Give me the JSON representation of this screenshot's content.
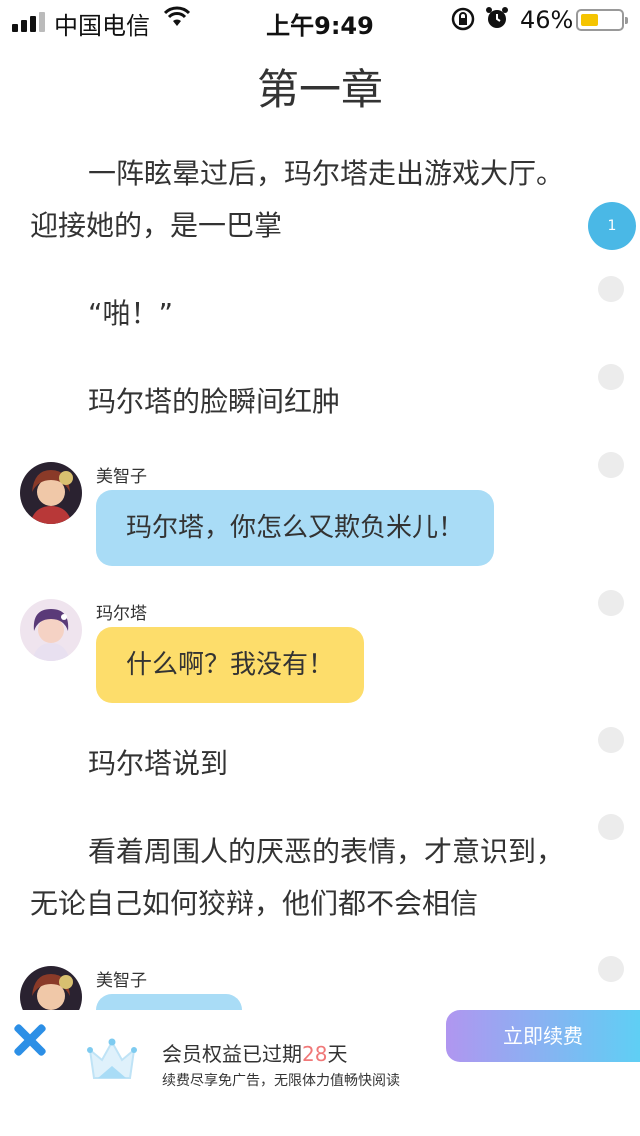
{
  "status_bar": {
    "carrier": "中国电信",
    "time": "上午9:49",
    "battery_percent": "46%",
    "battery_level": 0.46,
    "icons": [
      "signal-icon",
      "wifi-icon",
      "rotation-lock-icon",
      "alarm-icon",
      "battery-icon"
    ]
  },
  "chapter": {
    "title": "第一章",
    "paragraphs": {
      "p1": "一阵眩晕过后，玛尔塔走出游戏大厅。迎接她的，是一巴掌",
      "p2": "“啪！”",
      "p3": "玛尔塔的脸瞬间红肿",
      "p4": "玛尔塔说到",
      "p5": "看着周围人的厌恶的表情，才意识到，无论自己如何狡辩，他们都不会相信"
    },
    "messages": [
      {
        "speaker": "美智子",
        "text": "玛尔塔，你怎么又欺负米儿！",
        "color": "#a9dcf6"
      },
      {
        "speaker": "玛尔塔",
        "text": "什么啊？我没有！",
        "color": "#fddd6b"
      },
      {
        "speaker": "美智子",
        "text": "",
        "color": "#a9dcf6"
      }
    ]
  },
  "comment_rail": {
    "active_count": "1",
    "active_color": "#4ab8e6"
  },
  "footer": {
    "expired_prefix": "会员权益已过期",
    "expired_days": "28",
    "expired_suffix": "天",
    "subtitle": "续费尽享免广告，无限体力值畅快阅读",
    "renew_label": "立即续费",
    "close_color": "#2c8fe6"
  }
}
